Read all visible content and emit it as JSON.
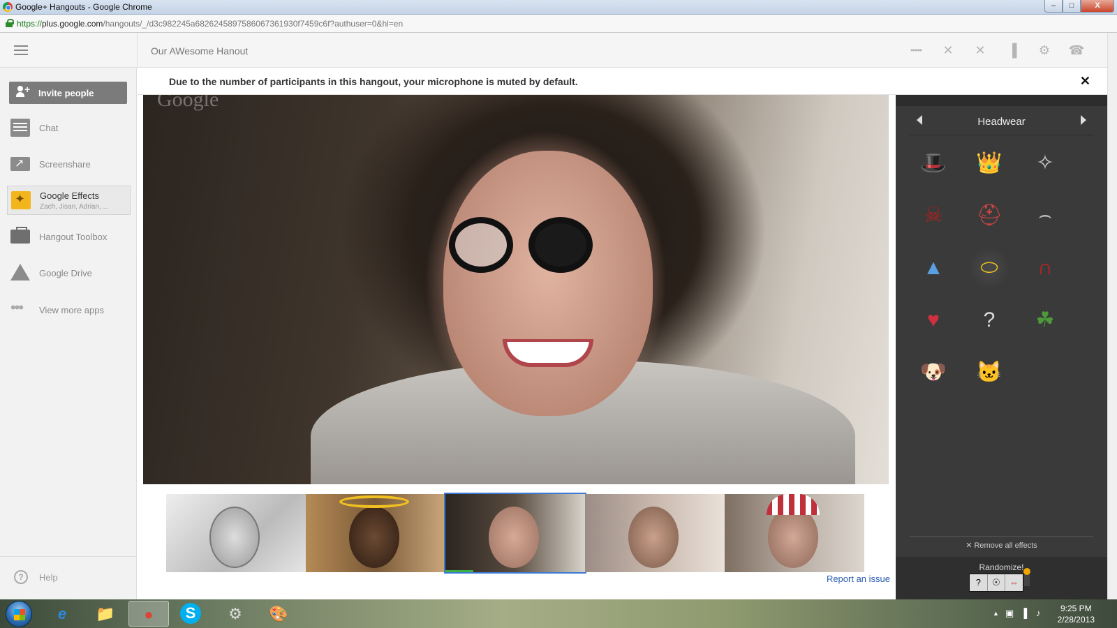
{
  "window": {
    "title": "Google+ Hangouts - Google Chrome",
    "min_glyph": "–",
    "max_glyph": "□",
    "close_glyph": "X"
  },
  "address": {
    "scheme": "https://",
    "host": "plus.google.com",
    "path": "/hangouts/_/d3c982245a6826245897586067361930f7459c6f?authuser=0&hl=en"
  },
  "header": {
    "title": "Our AWesome Hanout",
    "icons": [
      "signal-dots-icon",
      "mic-off-icon",
      "camera-off-icon",
      "bandwidth-icon",
      "settings-icon",
      "hang-up-icon"
    ],
    "icon_glyphs": [
      "•••••",
      "✕",
      "✕",
      "▐",
      "⚙",
      "☎"
    ]
  },
  "notice": {
    "message": "Due to the number of participants in this hangout, your microphone is muted by default.",
    "close_glyph": "✕"
  },
  "sidebar": {
    "invite": "Invite people",
    "items": [
      {
        "label": "Chat"
      },
      {
        "label": "Screenshare"
      },
      {
        "label": "Google Effects",
        "sub": "Zach, Jisan, Adrian, ..."
      },
      {
        "label": "Hangout Toolbox"
      },
      {
        "label": "Google Drive"
      },
      {
        "label": "View more apps"
      }
    ],
    "more_glyph": "•••",
    "help": "Help",
    "help_glyph": "?"
  },
  "main": {
    "watermark": "Google",
    "report_issue": "Report an issue",
    "selected_thumb": 2
  },
  "effects": {
    "category": "Headwear",
    "items": [
      {
        "name": "striped-top-hat",
        "glyph": "🎩"
      },
      {
        "name": "gold-crown",
        "glyph": "👑"
      },
      {
        "name": "tiara",
        "glyph": "✧"
      },
      {
        "name": "pirate-hat",
        "glyph": "☠"
      },
      {
        "name": "viking-helmet",
        "glyph": "⛑"
      },
      {
        "name": "google-visor",
        "glyph": "⌢"
      },
      {
        "name": "party-hat",
        "glyph": "▲"
      },
      {
        "name": "halo",
        "glyph": "⬭"
      },
      {
        "name": "devil-horns",
        "glyph": "∩"
      },
      {
        "name": "heart-headband",
        "glyph": "♥"
      },
      {
        "name": "mystery-effect",
        "glyph": "?"
      },
      {
        "name": "palm-leaf-hat",
        "glyph": "☘"
      },
      {
        "name": "dog-ears",
        "glyph": "🐶"
      },
      {
        "name": "cat-mask",
        "glyph": "🐱"
      }
    ],
    "selected_index": 7,
    "remove_all": "✕ Remove all effects",
    "randomize": "Randomize!",
    "slot_glyphs": [
      "?",
      "☉",
      "⇔"
    ]
  },
  "taskbar": {
    "buttons": [
      {
        "name": "internet-explorer",
        "glyph": "e"
      },
      {
        "name": "file-explorer",
        "glyph": "📁"
      },
      {
        "name": "chrome",
        "glyph": "●"
      },
      {
        "name": "skype",
        "glyph": "S"
      },
      {
        "name": "steam",
        "glyph": "⚙"
      },
      {
        "name": "paint",
        "glyph": "🎨"
      }
    ],
    "active_index": 2,
    "tray_glyphs": [
      "▲",
      "▣",
      "▐",
      "♪"
    ],
    "time": "9:25 PM",
    "date": "2/28/2013"
  }
}
